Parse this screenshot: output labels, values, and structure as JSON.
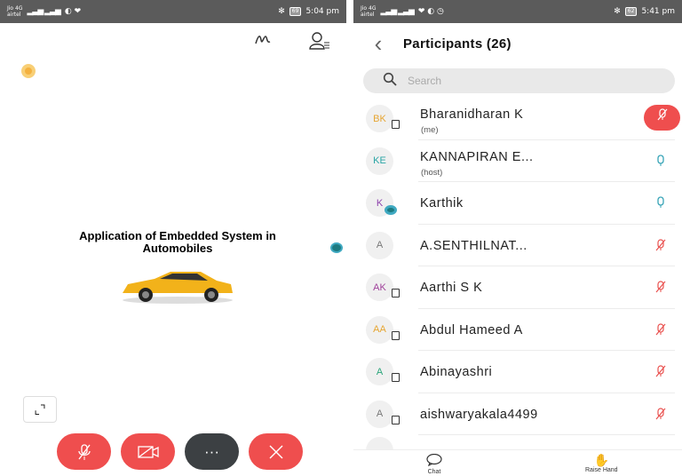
{
  "left": {
    "status": {
      "carrier": "Jio 4G",
      "carrier_sub": "airtel",
      "network": "4G",
      "volte": "VoLTE",
      "time": "5:04 pm",
      "battery": "69"
    },
    "slide_title": "Application of Embedded System in Automobiles",
    "icons": [
      "annotate-icon",
      "participants-icon",
      "expand-icon",
      "mic-off-icon",
      "video-off-icon",
      "more-icon",
      "end-call-icon"
    ],
    "more_label": "···",
    "expand_label": "⌞⌝"
  },
  "right": {
    "status": {
      "carrier": "Jio 4G",
      "carrier_sub": "airtel",
      "network": "4G",
      "volte": "VoLTE",
      "time": "5:41 pm",
      "battery": "62"
    },
    "title": "Participants (26)",
    "search_placeholder": "Search",
    "participants": [
      {
        "initials": "BK",
        "name": "Bharanidharan K",
        "sub": "(me)",
        "mic": "me",
        "device": "phone",
        "color": "#e6a532"
      },
      {
        "initials": "KE",
        "name": "KANNAPIRAN E...",
        "sub": "(host)",
        "mic": "on",
        "device": "none",
        "color": "#2aa5a5"
      },
      {
        "initials": "K",
        "name": "Karthik",
        "sub": "",
        "mic": "on",
        "device": "webcam",
        "color": "#8e44ad"
      },
      {
        "initials": "A",
        "name": "A.SENTHILNAT...",
        "sub": "",
        "mic": "off",
        "device": "none",
        "color": "#777777"
      },
      {
        "initials": "AK",
        "name": "Aarthi S K",
        "sub": "",
        "mic": "off",
        "device": "phone",
        "color": "#a0419b"
      },
      {
        "initials": "AA",
        "name": "Abdul Hameed A",
        "sub": "",
        "mic": "off",
        "device": "phone",
        "color": "#e6a532"
      },
      {
        "initials": "A",
        "name": "Abinayashri",
        "sub": "",
        "mic": "off",
        "device": "phone",
        "color": "#2aa57a"
      },
      {
        "initials": "A",
        "name": "aishwaryakala4499",
        "sub": "",
        "mic": "off",
        "device": "phone",
        "color": "#777777"
      }
    ],
    "bottom": {
      "chat": "Chat",
      "raise_hand": "Raise Hand"
    }
  },
  "colors": {
    "accent_red": "#ef4e4e",
    "mic_on": "#35a3b6",
    "statusbar": "#5b5b5b"
  }
}
